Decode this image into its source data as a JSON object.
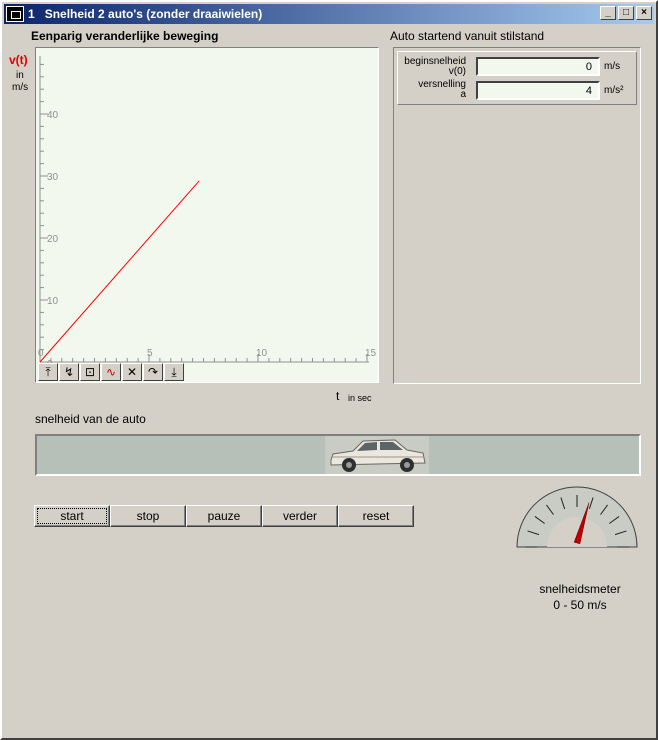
{
  "window": {
    "number": "1",
    "title": "Snelheid 2 auto's (zonder draaiwielen)",
    "controls": [
      "_",
      "□",
      "×"
    ]
  },
  "graph": {
    "title": "Eenparig veranderlijke beweging",
    "ylabel": "v(t)",
    "yunit_1": "in",
    "yunit_2": "m/s",
    "xlabel": "t",
    "xunit": "in sec",
    "tools": [
      "⤒",
      "↯",
      "⊡",
      "∿",
      "✕",
      "↷",
      "⤓"
    ]
  },
  "chart_data": {
    "type": "line",
    "x": [
      0,
      7.3
    ],
    "y": [
      0,
      29.2
    ],
    "xlim": [
      0,
      15
    ],
    "ylim": [
      0,
      50
    ],
    "xticks": [
      0,
      5,
      10,
      15
    ],
    "yticks": [
      0,
      10,
      20,
      30,
      40
    ],
    "line_color": "#ff0000",
    "background": "#f3f8ef",
    "grid": false
  },
  "panel": {
    "title": "Auto startend vanuit stilstand",
    "fields": [
      {
        "label_1": "beginsnelheid",
        "label_2": "v(0)",
        "value": "0",
        "unit": "m/s"
      },
      {
        "label_1": "versnelling",
        "label_2": "a",
        "value": "4",
        "unit": "m/s²"
      }
    ]
  },
  "track": {
    "label": "snelheid van de auto"
  },
  "buttons": {
    "start": "start",
    "stop": "stop",
    "pauze": "pauze",
    "verder": "verder",
    "reset": "reset"
  },
  "gauge": {
    "label": "snelheidsmeter",
    "range": "0 - 50 m/s",
    "value": 29.2,
    "min": 0,
    "max": 50
  }
}
